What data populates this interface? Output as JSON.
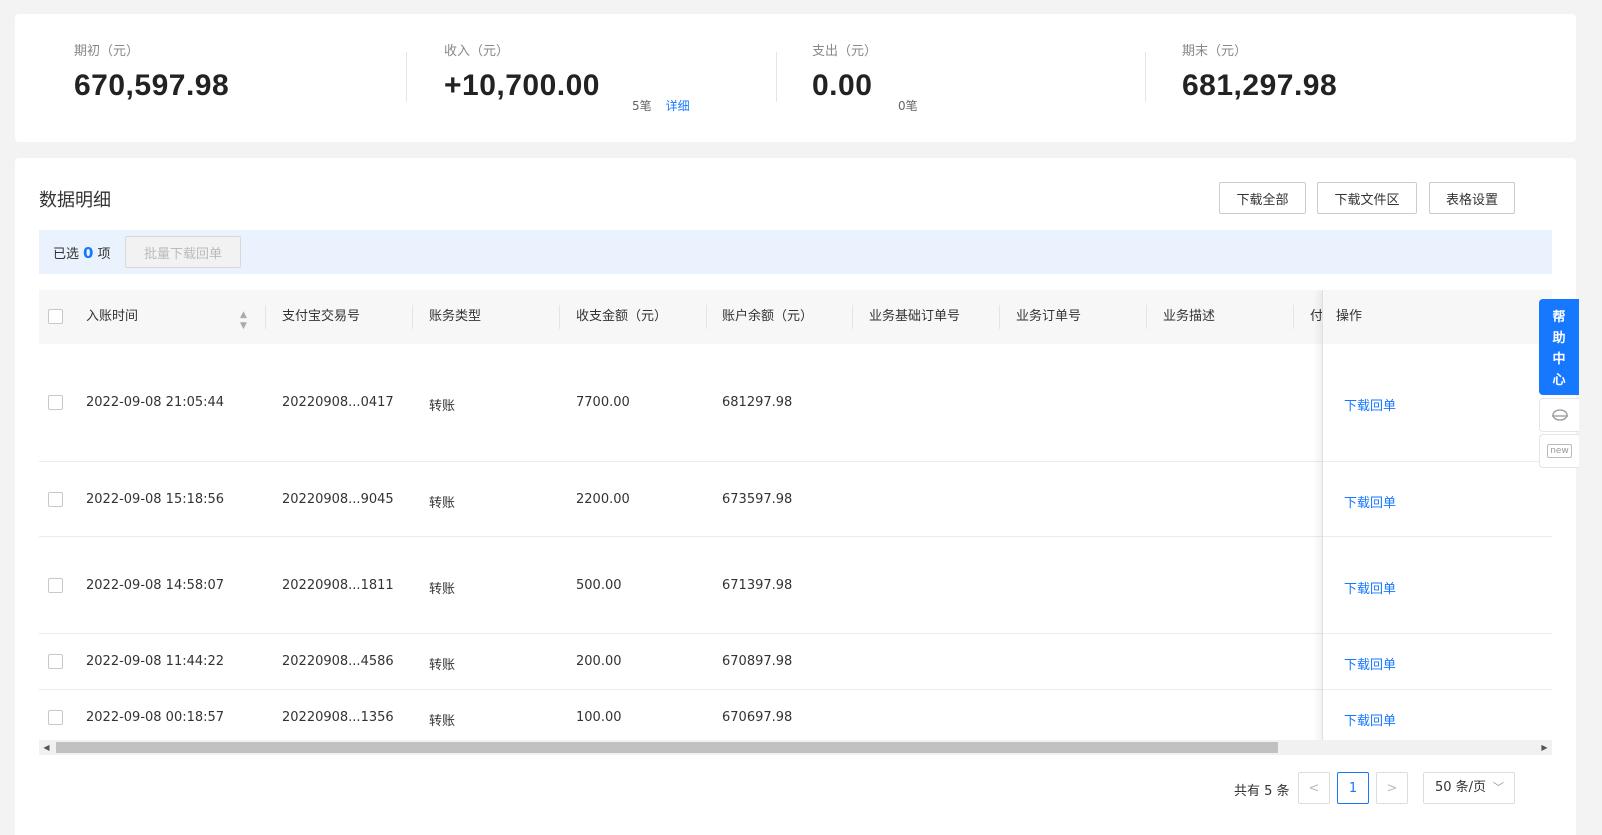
{
  "summary": {
    "opening": {
      "label": "期初（元）",
      "value": "670,597.98"
    },
    "income": {
      "label": "收入（元）",
      "value": "+10,700.00",
      "count": "5笔",
      "detail_link": "详细"
    },
    "expense": {
      "label": "支出（元）",
      "value": "0.00",
      "count": "0笔"
    },
    "closing": {
      "label": "期末（元）",
      "value": "681,297.98"
    }
  },
  "detail": {
    "title": "数据明细",
    "buttons": {
      "download_all": "下载全部",
      "download_area": "下载文件区",
      "table_settings": "表格设置"
    },
    "selection": {
      "prefix": "已选",
      "count": "0",
      "suffix": "项",
      "batch_button": "批量下载回单"
    },
    "columns": [
      "入账时间",
      "支付宝交易号",
      "账务类型",
      "收支金额（元）",
      "账户余额（元）",
      "业务基础订单号",
      "业务订单号",
      "业务描述",
      "付",
      "操作"
    ],
    "rows": [
      {
        "time": "2022-09-08 21:05:44",
        "trade_no": "20220908...0417",
        "type": "转账",
        "amount": "7700.00",
        "balance": "681297.98",
        "action": "下载回单"
      },
      {
        "time": "2022-09-08 15:18:56",
        "trade_no": "20220908...9045",
        "type": "转账",
        "amount": "2200.00",
        "balance": "673597.98",
        "action": "下载回单"
      },
      {
        "time": "2022-09-08 14:58:07",
        "trade_no": "20220908...1811",
        "type": "转账",
        "amount": "500.00",
        "balance": "671397.98",
        "action": "下载回单"
      },
      {
        "time": "2022-09-08 11:44:22",
        "trade_no": "20220908...4586",
        "type": "转账",
        "amount": "200.00",
        "balance": "670897.98",
        "action": "下载回单"
      },
      {
        "time": "2022-09-08 00:18:57",
        "trade_no": "20220908...1356",
        "type": "转账",
        "amount": "100.00",
        "balance": "670697.98",
        "action": "下载回单"
      }
    ]
  },
  "pagination": {
    "total": "共有 5 条",
    "prev": "<",
    "current": "1",
    "next": ">",
    "page_size": "50 条/页"
  },
  "side": {
    "help_chars": [
      "帮",
      "助",
      "中",
      "心"
    ],
    "new_badge": "new"
  },
  "colors": {
    "accent": "#1677ff",
    "select_bar": "#eaf2fd"
  }
}
